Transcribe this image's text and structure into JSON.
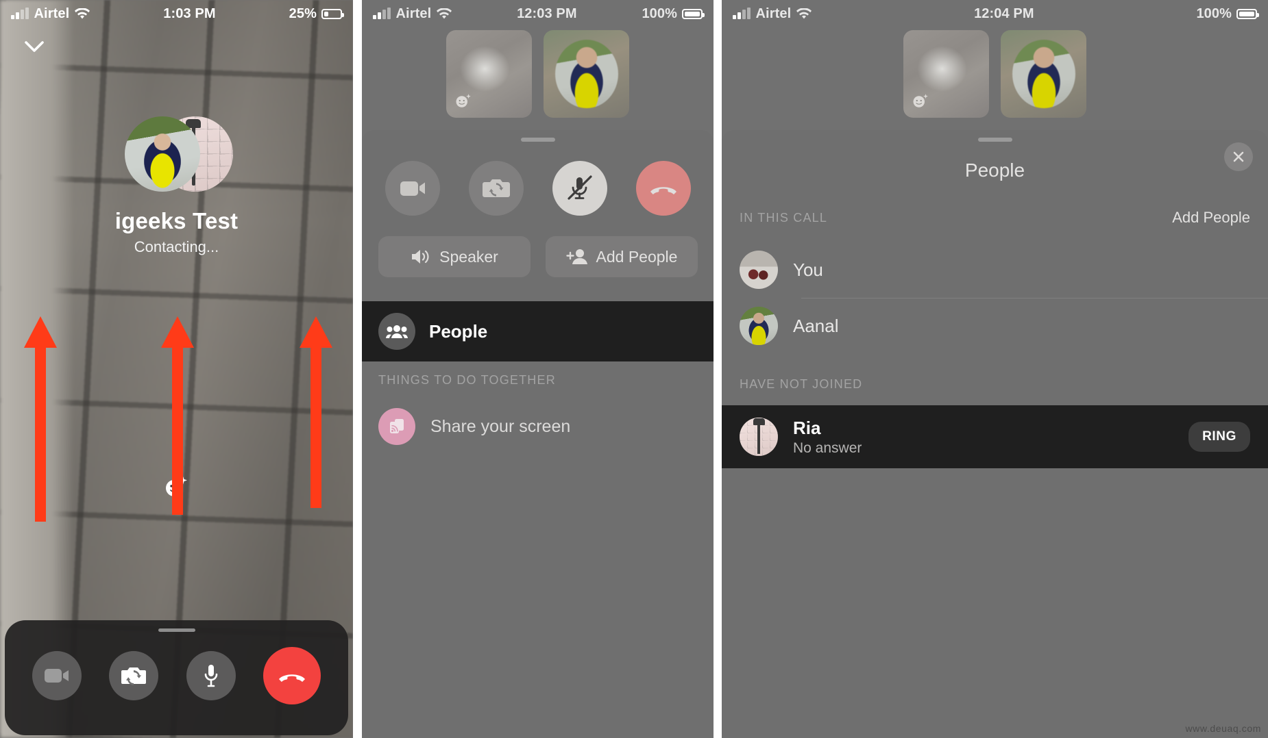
{
  "panel1": {
    "status_bar": {
      "carrier": "Airtel",
      "wifi_icon": "wifi-icon",
      "time": "1:03 PM",
      "battery": "25%"
    },
    "collapse_icon": "chevron-down-icon",
    "callee_name": "igeeks Test",
    "callee_status": "Contacting...",
    "memoji_icon": "memoji-effects-icon",
    "controls": [
      {
        "name": "video-toggle-button",
        "icon": "video-camera-icon"
      },
      {
        "name": "flip-camera-button",
        "icon": "camera-flip-icon"
      },
      {
        "name": "mute-button",
        "icon": "microphone-icon"
      },
      {
        "name": "end-call-button",
        "icon": "end-call-handset-icon"
      }
    ]
  },
  "panel2": {
    "status_bar": {
      "carrier": "Airtel",
      "wifi_icon": "wifi-icon",
      "time": "12:03 PM",
      "battery": "100%"
    },
    "tiles": [
      {
        "name": "self-video-tile",
        "badge_icon": "memoji-effects-icon"
      },
      {
        "name": "participant-video-tile"
      }
    ],
    "controls": [
      {
        "name": "video-toggle-button",
        "icon": "video-camera-icon",
        "state": "off"
      },
      {
        "name": "flip-camera-button",
        "icon": "camera-flip-icon",
        "state": "off"
      },
      {
        "name": "mute-button",
        "icon": "microphone-muted-icon",
        "state": "on"
      },
      {
        "name": "end-call-button",
        "icon": "end-call-handset-icon",
        "state": "default"
      }
    ],
    "pills": [
      {
        "name": "speaker-button",
        "label": "Speaker",
        "icon": "speaker-icon"
      },
      {
        "name": "add-people-button",
        "label": "Add People",
        "icon": "add-person-icon"
      }
    ],
    "people_row": {
      "label": "People",
      "icon": "people-group-icon"
    },
    "section_title": "THINGS TO DO TOGETHER",
    "share_screen": {
      "label": "Share your screen",
      "icon": "share-screen-icon",
      "accent": "#dc9cb5"
    }
  },
  "panel3": {
    "status_bar": {
      "carrier": "Airtel",
      "wifi_icon": "wifi-icon",
      "time": "12:04 PM",
      "battery": "100%"
    },
    "sheet_title": "People",
    "close_icon": "close-icon",
    "in_call_label": "IN THIS CALL",
    "add_people_label": "Add People",
    "in_call": [
      {
        "name": "You",
        "avatar": "you-avatar"
      },
      {
        "name": "Aanal",
        "avatar": "aanal-avatar"
      }
    ],
    "not_joined_label": "HAVE NOT JOINED",
    "not_joined": [
      {
        "name": "Ria",
        "status": "No answer",
        "action": "RING",
        "avatar": "ria-avatar"
      }
    ]
  },
  "watermark": "www.deuaq.com",
  "colors": {
    "arrow": "#ff3b18",
    "end_call": "#f3423f",
    "pink_accent": "#dc9cb5",
    "dark_row": "#1f1f1f"
  }
}
